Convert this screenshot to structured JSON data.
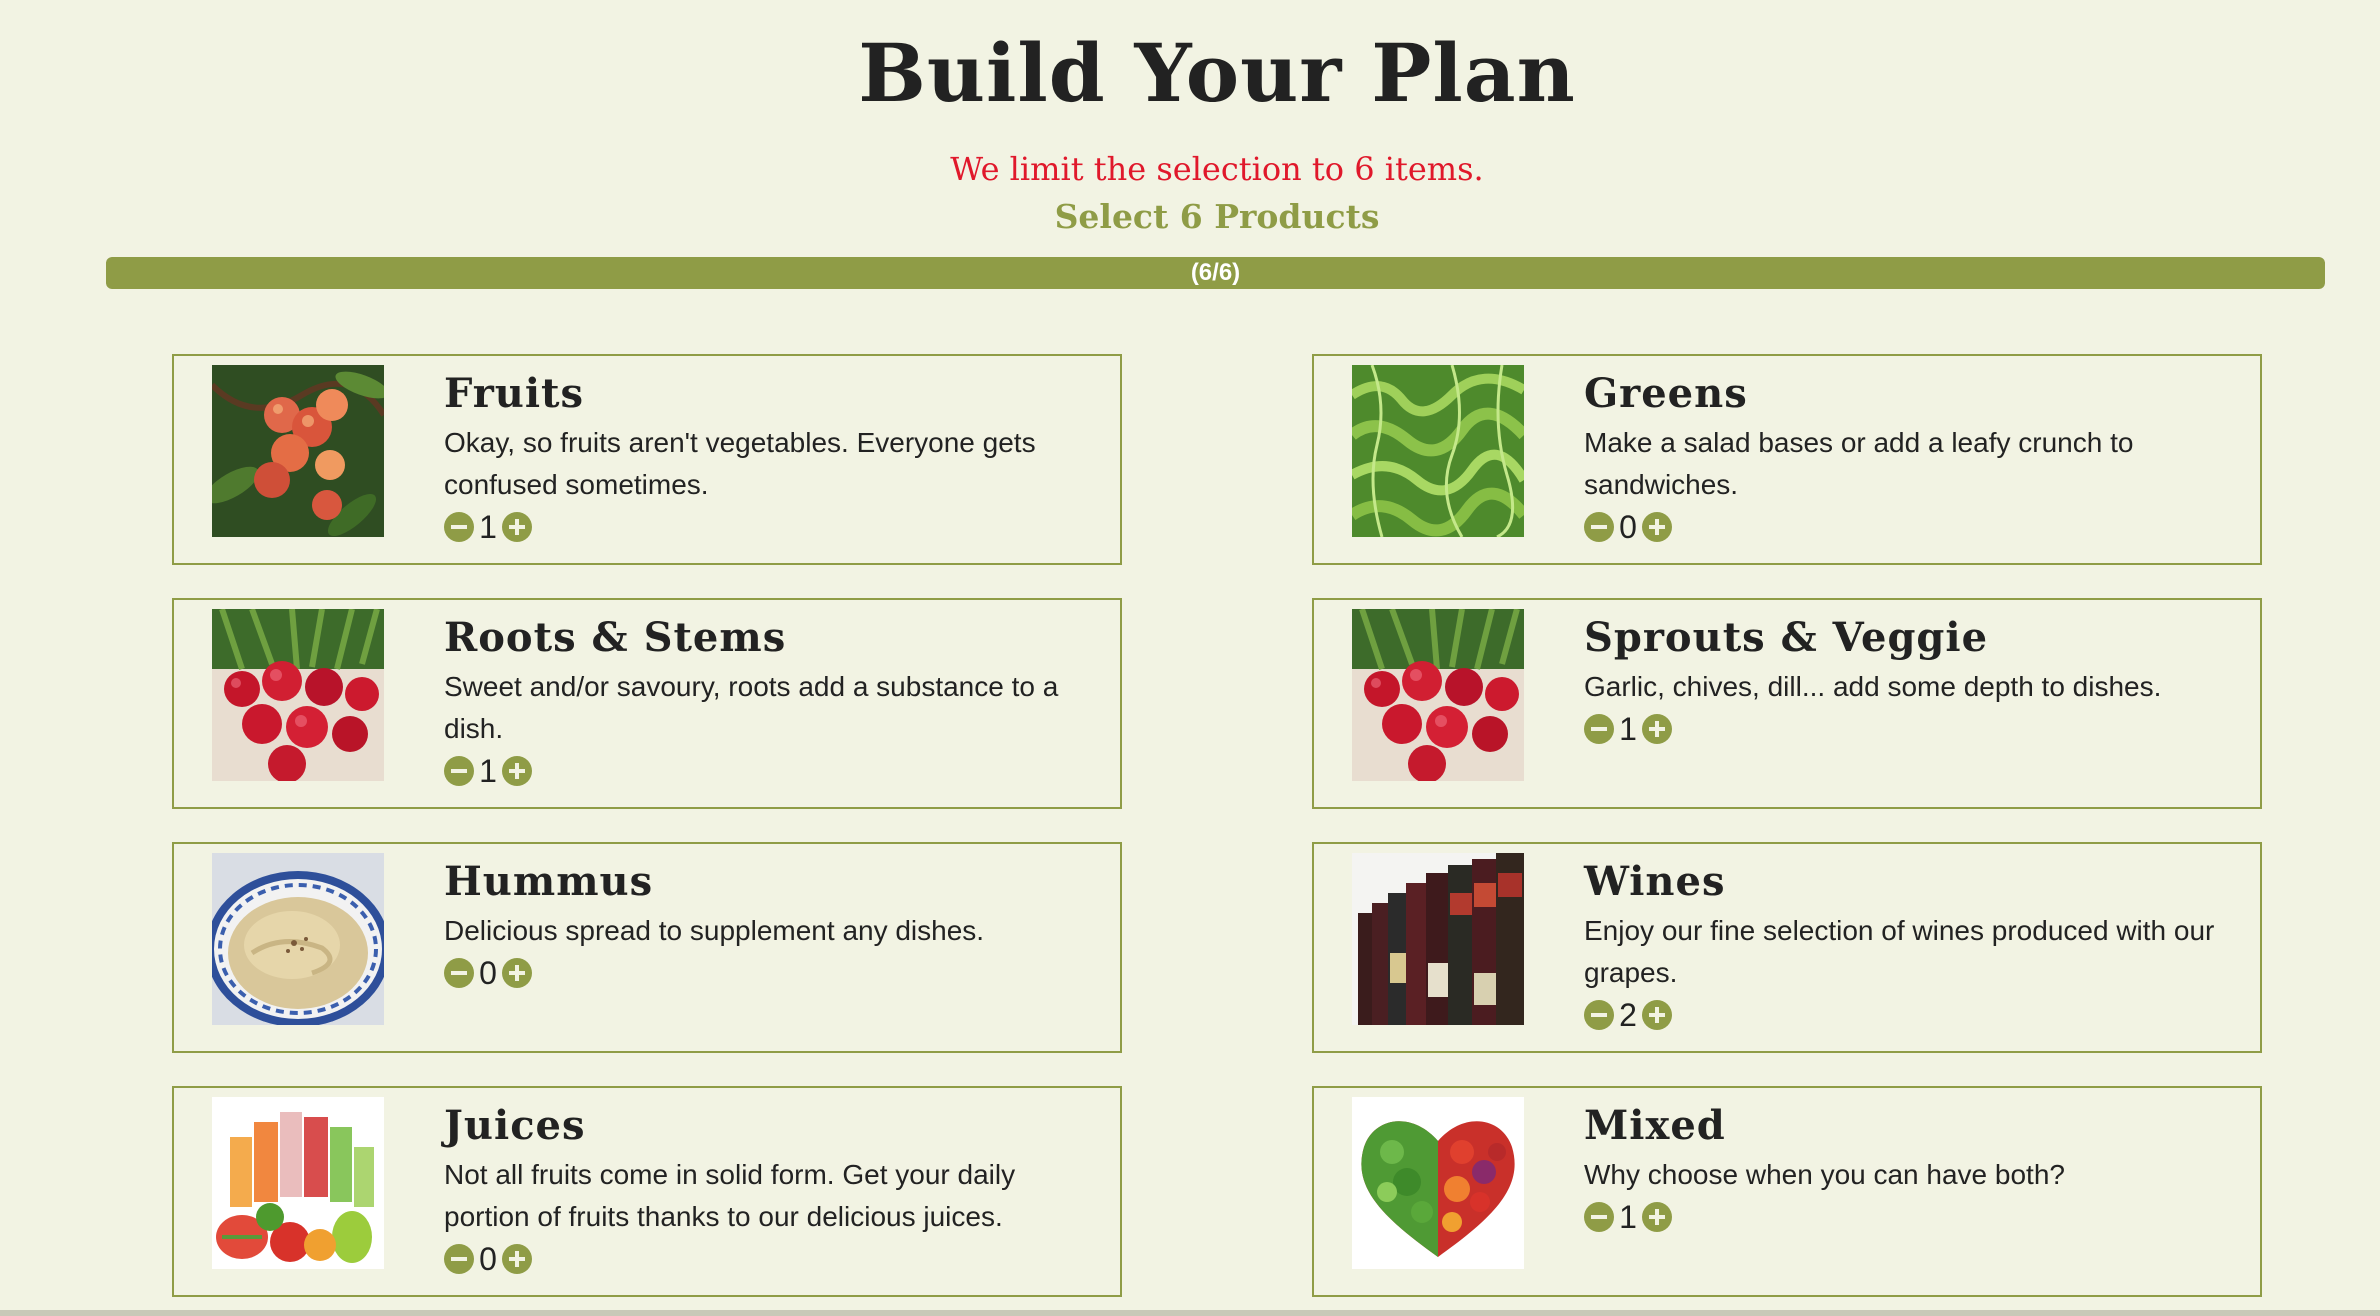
{
  "header": {
    "title": "Build Your Plan",
    "limit_notice": "We limit the selection to 6 items.",
    "select_label": "Select 6 Products"
  },
  "progress": {
    "label": "(6/6)",
    "fraction": 1.0
  },
  "colors": {
    "accent": "#8f9c46",
    "warning": "#e0182b",
    "background": "#f2f3e3",
    "text": "#222222"
  },
  "products": [
    {
      "title": "Fruits",
      "description": "Okay, so fruits aren't vegetables. Everyone gets confused sometimes.",
      "quantity": "1",
      "image": "peaches-photo"
    },
    {
      "title": "Greens",
      "description": "Make a salad bases or add a leafy crunch to sandwiches.",
      "quantity": "0",
      "image": "lettuce-photo"
    },
    {
      "title": "Roots & Stems",
      "description": "Sweet and/or savoury, roots add a substance to a dish.",
      "quantity": "1",
      "image": "radishes-photo"
    },
    {
      "title": "Sprouts & Veggie",
      "description": "Garlic, chives, dill... add some depth to dishes.",
      "quantity": "1",
      "image": "radishes-photo"
    },
    {
      "title": "Hummus",
      "description": "Delicious spread to supplement any dishes.",
      "quantity": "0",
      "image": "hummus-photo"
    },
    {
      "title": "Wines",
      "description": "Enjoy our fine selection of wines produced with our grapes.",
      "quantity": "2",
      "image": "wine-bottles-photo"
    },
    {
      "title": "Juices",
      "description": "Not all fruits come in solid form. Get your daily portion of fruits thanks to our delicious juices.",
      "quantity": "0",
      "image": "juices-photo"
    },
    {
      "title": "Mixed",
      "description": "Why choose when you can have both?",
      "quantity": "1",
      "image": "vegetable-heart-photo"
    }
  ],
  "icons": {
    "decrease": "minus-circle-icon",
    "increase": "plus-circle-icon"
  }
}
